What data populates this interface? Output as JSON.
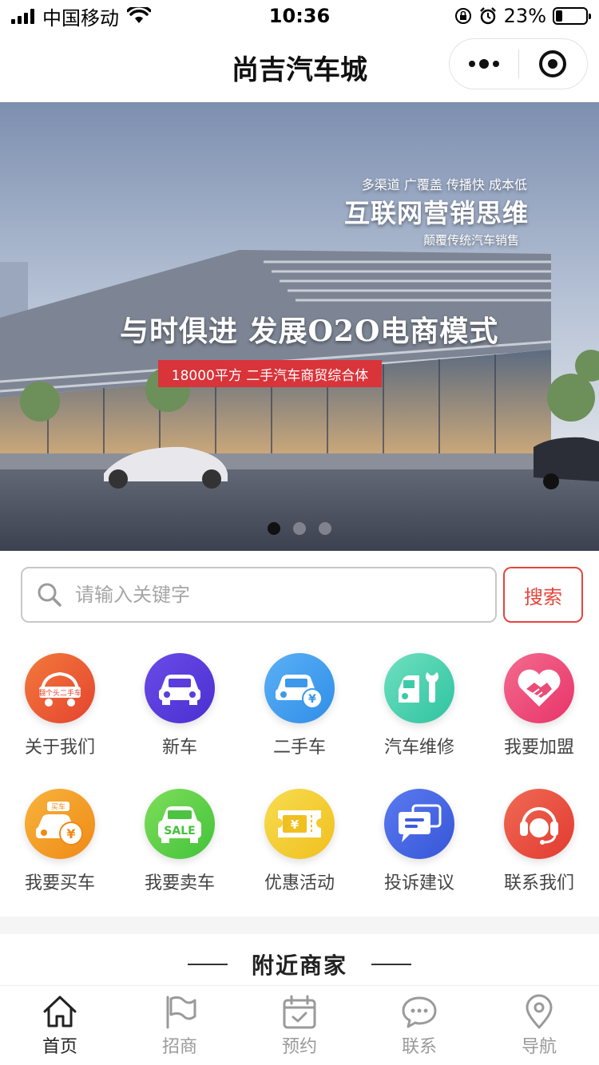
{
  "status_bar": {
    "carrier": "中国移动",
    "time": "10:36",
    "battery": "23%",
    "battery_level": 0.23
  },
  "nav": {
    "title": "尚吉汽车城",
    "more_icon": "more-dots-icon",
    "close_icon": "target-icon"
  },
  "banner": {
    "subtitle_top": "多渠道 广覆盖 传播快 成本低",
    "headline": "互联网营销思维",
    "subtitle_bottom": "颠覆传统汽车销售",
    "slogan": "与时俱进  发展O2O电商模式",
    "tag": "18000平方   二手汽车商贸综合体",
    "slide_count": 3,
    "active_slide": 1
  },
  "search": {
    "placeholder": "请输入关键字",
    "value": "",
    "button_label": "搜索"
  },
  "menu": [
    {
      "label": "关于我们",
      "icon": "logo-badge-icon",
      "color": "#e5432f",
      "color2": "#f27a3b",
      "badge": "翻个头二手车"
    },
    {
      "label": "新车",
      "icon": "car-icon",
      "color": "#4a2fd0",
      "color2": "#6a4be8"
    },
    {
      "label": "二手车",
      "icon": "car-yuan-icon",
      "color": "#2f8ee8",
      "color2": "#5bb0f5"
    },
    {
      "label": "汽车维修",
      "icon": "car-wrench-icon",
      "color": "#2ec3a0",
      "color2": "#6fe0c0"
    },
    {
      "label": "我要加盟",
      "icon": "heart-handshake-icon",
      "color": "#e8336a",
      "color2": "#f36b8e"
    },
    {
      "label": "我要买车",
      "icon": "buy-car-icon",
      "color": "#ef8a16",
      "color2": "#f7b33d",
      "badge": "买车"
    },
    {
      "label": "我要卖车",
      "icon": "sale-car-icon",
      "color": "#43c23a",
      "color2": "#7ede5a",
      "badge": "SALE"
    },
    {
      "label": "优惠活动",
      "icon": "coupon-icon",
      "color": "#f0c01f",
      "color2": "#f7dc4f"
    },
    {
      "label": "投诉建议",
      "icon": "chat-bubbles-icon",
      "color": "#3756d8",
      "color2": "#5a7af0"
    },
    {
      "label": "联系我们",
      "icon": "headset-icon",
      "color": "#e23a30",
      "color2": "#f06a55"
    }
  ],
  "nearby": {
    "title": "附近商家"
  },
  "tabs": [
    {
      "label": "首页",
      "icon": "home-icon",
      "active": true
    },
    {
      "label": "招商",
      "icon": "flag-icon",
      "active": false
    },
    {
      "label": "预约",
      "icon": "calendar-check-icon",
      "active": false
    },
    {
      "label": "联系",
      "icon": "chat-icon",
      "active": false
    },
    {
      "label": "导航",
      "icon": "location-pin-icon",
      "active": false
    }
  ]
}
